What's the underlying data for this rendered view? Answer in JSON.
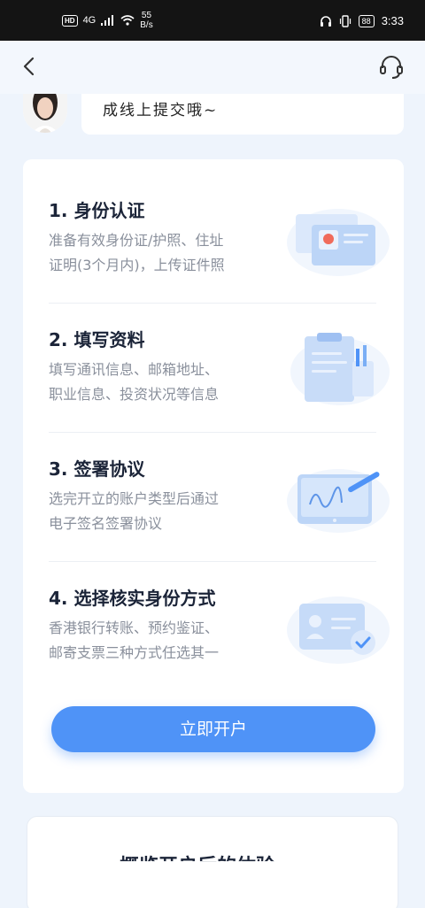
{
  "status_bar": {
    "hd": "HD",
    "network": "4G",
    "speed_value": "55",
    "speed_unit": "B/s",
    "battery": "88",
    "time": "3:33"
  },
  "chat": {
    "message": "成线上提交哦~"
  },
  "steps": [
    {
      "title": "1. 身份认证",
      "line1": "准备有效身份证/护照、住址",
      "line2": "证明(3个月内)，上传证件照"
    },
    {
      "title": "2. 填写资料",
      "line1": "填写通讯信息、邮箱地址、",
      "line2": "职业信息、投资状况等信息"
    },
    {
      "title": "3. 签署协议",
      "line1": "选完开立的账户类型后通过",
      "line2": "电子签名签署协议"
    },
    {
      "title": "4. 选择核实身份方式",
      "line1": "香港银行转账、预约鉴证、",
      "line2": "邮寄支票三种方式任选其一"
    }
  ],
  "open_button": "立即开户",
  "next_card_title": "概览开户后的体验",
  "colors": {
    "accent": "#4f93f7",
    "illustration_light": "#dbe8fb",
    "illustration_mid": "#a9c8f5",
    "background": "#eef4fc"
  },
  "icons": {
    "back": "chevron-left-icon",
    "support": "headset-icon"
  }
}
